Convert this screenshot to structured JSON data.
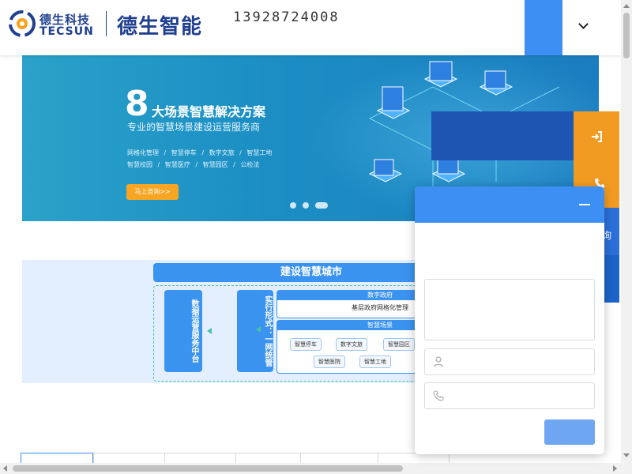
{
  "header": {
    "logo_cn": "德生科技",
    "logo_en": "TECSUN",
    "brand": "德生智能",
    "slogan": "",
    "phone": "13928724008",
    "nav_home": "",
    "nav_more": "",
    "brand_color": "#1f3f8f",
    "accent_color": "#3d8ff3"
  },
  "banner": {
    "number": "8",
    "title": "大场景智慧解决方案",
    "subtitle": "专业的智慧场景建设运营服务商",
    "tags_row1": [
      "网格化管理",
      "/",
      "智慧停车",
      "/",
      "数字文旅",
      "/",
      "智慧工地"
    ],
    "tags_row2": [
      "智慧校园",
      "/",
      "智慧医疗",
      "/",
      "智慧园区",
      "/",
      "公检法"
    ],
    "cta": "马上咨询>>",
    "slides": 3,
    "active_slide": 3
  },
  "city_diagram": {
    "title": "建设智慧城市",
    "col1": "城市级",
    "col2": "数据运营服务中台",
    "col3": "实行形式：一网统管",
    "box_a_title": "数字政府",
    "box_a_body": "基层政府网格化管理",
    "box_b_title": "智慧场景",
    "chips_row1": [
      "智慧停车",
      "数字文旅",
      "智慧园区"
    ],
    "chips_row2": [
      "智慧医院",
      "智慧工地"
    ]
  },
  "section": {
    "title": ""
  },
  "float": {
    "login_label": "",
    "consult_label": "询",
    "orange": "#f29b22",
    "navy": "#1e55b3"
  },
  "popup": {
    "title": "",
    "intro": "",
    "message_placeholder": "",
    "name_placeholder": "",
    "phone_placeholder": "",
    "submit_label": ""
  }
}
